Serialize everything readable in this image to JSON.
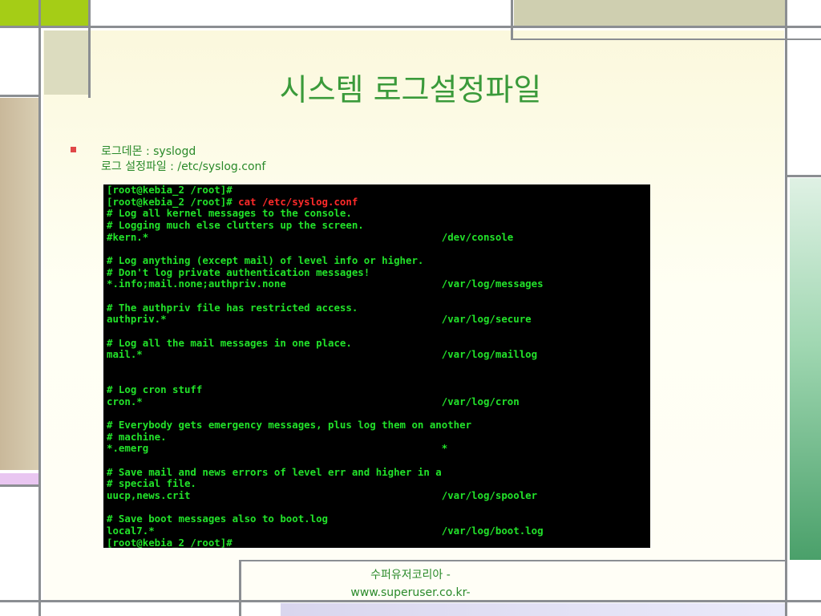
{
  "slide": {
    "title": "시스템 로그설정파일",
    "bullet": {
      "line1": "로그데몬 : syslogd",
      "line2": "로그 설정파일 : /etc/syslog.conf"
    },
    "footer": {
      "line1": "수퍼유저코리아 -",
      "line2": "www.superuser.co.kr-"
    }
  },
  "terminal": {
    "prompt": "[root@kebia_2 /root]#",
    "command": " cat /etc/syslog.conf",
    "lines": [
      "# Log all kernel messages to the console.",
      "# Logging much else clutters up the screen.",
      "#kern.*                                                 /dev/console",
      "",
      "# Log anything (except mail) of level info or higher.",
      "# Don't log private authentication messages!",
      "*.info;mail.none;authpriv.none                          /var/log/messages",
      "",
      "# The authpriv file has restricted access.",
      "authpriv.*                                              /var/log/secure",
      "",
      "# Log all the mail messages in one place.",
      "mail.*                                                  /var/log/maillog",
      "",
      "",
      "# Log cron stuff",
      "cron.*                                                  /var/log/cron",
      "",
      "# Everybody gets emergency messages, plus log them on another",
      "# machine.",
      "*.emerg                                                 *",
      "",
      "# Save mail and news errors of level err and higher in a",
      "# special file.",
      "uucp,news.crit                                          /var/log/spooler",
      "",
      "# Save boot messages also to boot.log",
      "local7.*                                                /var/log/boot.log"
    ]
  },
  "colors": {
    "accent_green": "#a5cd16",
    "text_green": "#2a8a2a",
    "terminal_green": "#22e22a",
    "terminal_red": "#ff2a2a"
  }
}
